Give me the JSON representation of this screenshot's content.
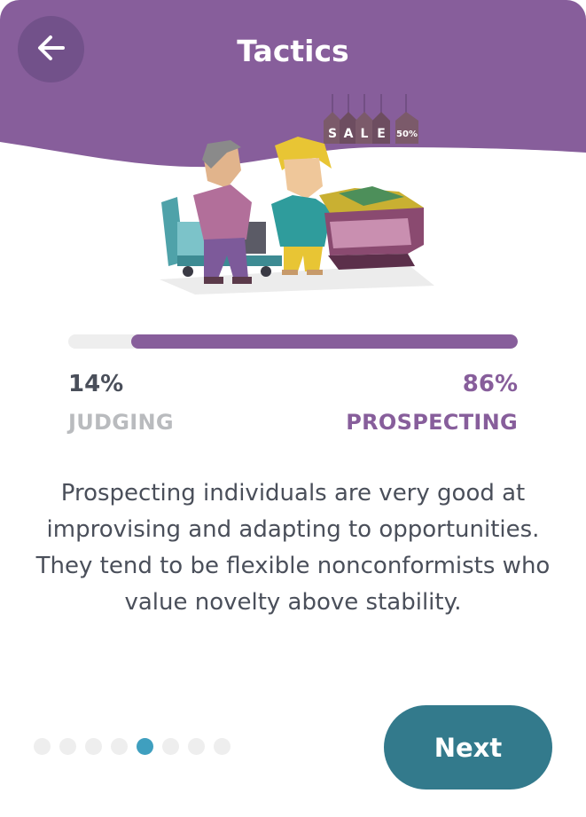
{
  "header": {
    "title": "Tactics",
    "back_icon": "arrow-left-icon",
    "background_color": "#875e9b"
  },
  "illustration": {
    "sale_tag_letters": [
      "S",
      "A",
      "L",
      "E"
    ],
    "discount_tag": "50%"
  },
  "trait": {
    "left_percent": "14%",
    "left_label": "JUDGING",
    "right_percent": "86%",
    "right_label": "PROSPECTING",
    "fill_fraction": 0.86,
    "accent_color": "#875e9b"
  },
  "description": "Prospecting individuals are very good at improvising and adapting to opportunities. They tend to be flexible nonconformists who value novelty above stability.",
  "pagination": {
    "total": 8,
    "active_index": 4,
    "active_color": "#3f9fbf"
  },
  "footer": {
    "next_label": "Next",
    "button_color": "#337a8c"
  }
}
